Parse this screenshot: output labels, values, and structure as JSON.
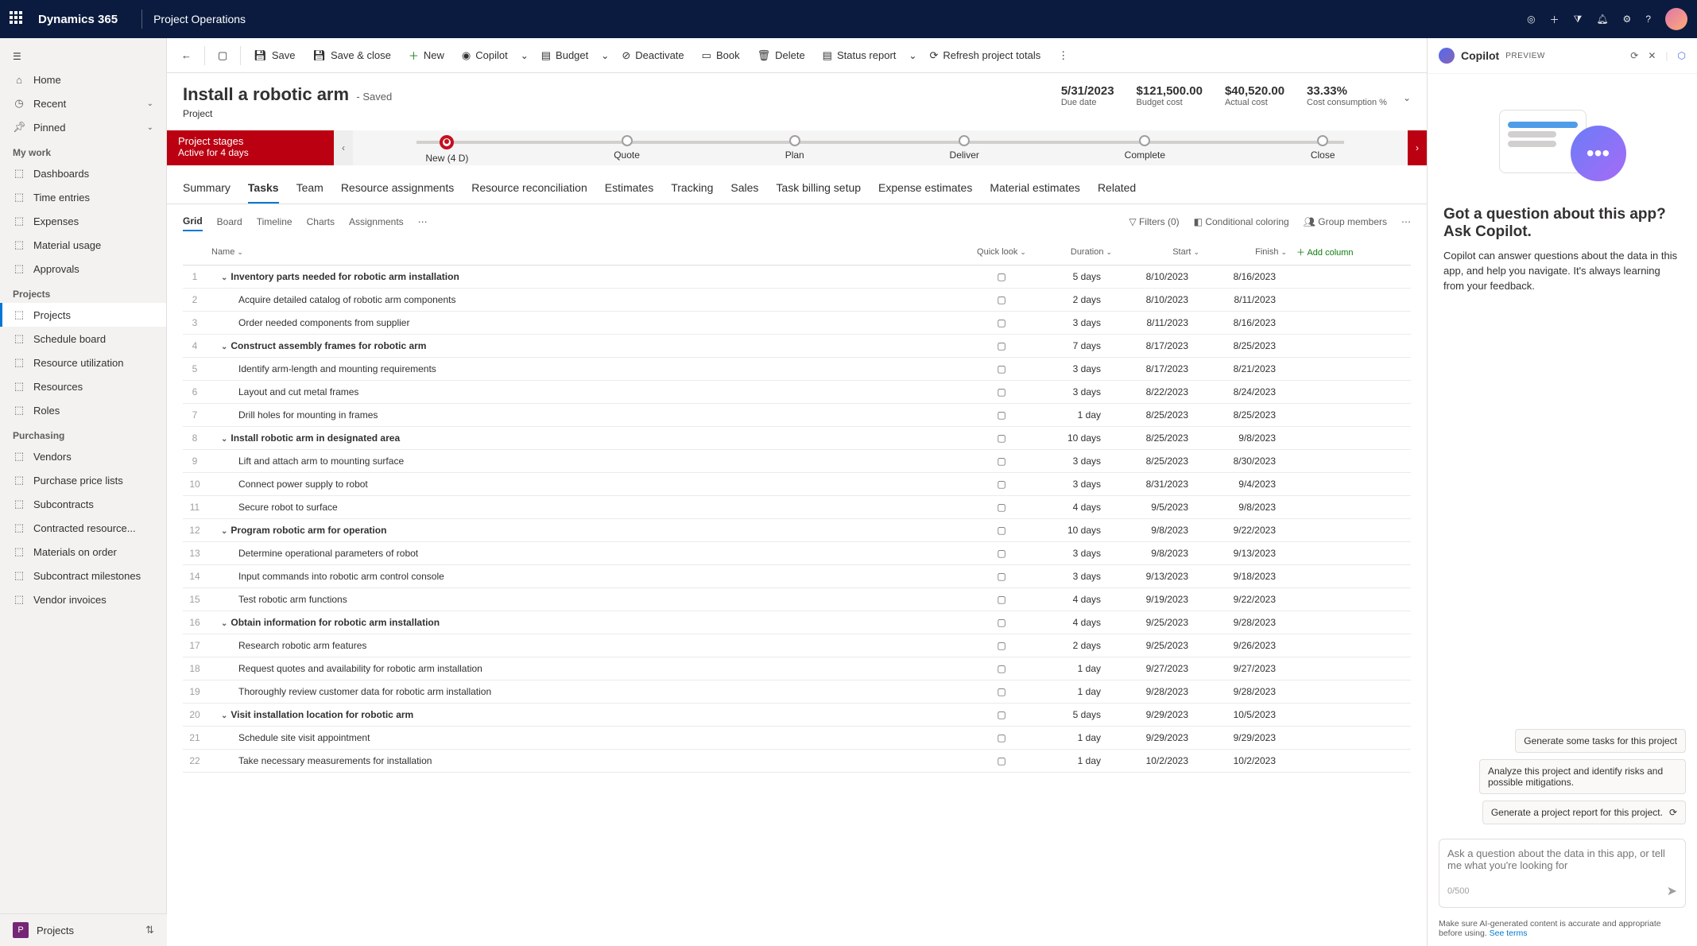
{
  "topbar": {
    "brand": "Dynamics 365",
    "module": "Project Operations"
  },
  "leftnav": {
    "home": "Home",
    "recent": "Recent",
    "pinned": "Pinned",
    "sections": {
      "mywork": {
        "title": "My work",
        "items": [
          "Dashboards",
          "Time entries",
          "Expenses",
          "Material usage",
          "Approvals"
        ]
      },
      "projects": {
        "title": "Projects",
        "items": [
          "Projects",
          "Schedule board",
          "Resource utilization",
          "Resources",
          "Roles"
        ]
      },
      "purchasing": {
        "title": "Purchasing",
        "items": [
          "Vendors",
          "Purchase price lists",
          "Subcontracts",
          "Contracted resource...",
          "Materials on order",
          "Subcontract milestones",
          "Vendor invoices"
        ]
      }
    },
    "bottom": {
      "badge": "P",
      "label": "Projects"
    }
  },
  "cmdbar": {
    "save": "Save",
    "saveclose": "Save & close",
    "new": "New",
    "copilot": "Copilot",
    "budget": "Budget",
    "deactivate": "Deactivate",
    "book": "Book",
    "delete": "Delete",
    "statusreport": "Status report",
    "refresh": "Refresh project totals"
  },
  "record": {
    "title": "Install a robotic arm",
    "saved": "- Saved",
    "subtitle": "Project",
    "metrics": [
      {
        "val": "5/31/2023",
        "lbl": "Due date"
      },
      {
        "val": "$121,500.00",
        "lbl": "Budget cost"
      },
      {
        "val": "$40,520.00",
        "lbl": "Actual cost"
      },
      {
        "val": "33.33%",
        "lbl": "Cost consumption %"
      }
    ]
  },
  "stages": {
    "label_title": "Project stages",
    "label_sub": "Active for 4 days",
    "nodes": [
      "New (4 D)",
      "Quote",
      "Plan",
      "Deliver",
      "Complete",
      "Close"
    ]
  },
  "tabs": [
    "Summary",
    "Tasks",
    "Team",
    "Resource assignments",
    "Resource reconciliation",
    "Estimates",
    "Tracking",
    "Sales",
    "Task billing setup",
    "Expense estimates",
    "Material estimates",
    "Related"
  ],
  "active_tab": "Tasks",
  "subtabs": [
    "Grid",
    "Board",
    "Timeline",
    "Charts",
    "Assignments"
  ],
  "active_subtab": "Grid",
  "gridtools": {
    "filters": "Filters (0)",
    "conditional": "Conditional coloring",
    "group": "Group members"
  },
  "grid": {
    "cols": {
      "name": "Name",
      "quicklook": "Quick look",
      "duration": "Duration",
      "start": "Start",
      "finish": "Finish",
      "addcol": "Add column"
    },
    "rows": [
      {
        "idx": 1,
        "parent": true,
        "name": "Inventory parts needed for robotic arm installation",
        "dur": "5 days",
        "start": "8/10/2023",
        "finish": "8/16/2023"
      },
      {
        "idx": 2,
        "name": "Acquire detailed catalog of robotic arm components",
        "dur": "2 days",
        "start": "8/10/2023",
        "finish": "8/11/2023"
      },
      {
        "idx": 3,
        "name": "Order needed components from supplier",
        "dur": "3 days",
        "start": "8/11/2023",
        "finish": "8/16/2023"
      },
      {
        "idx": 4,
        "parent": true,
        "name": "Construct assembly frames for robotic arm",
        "dur": "7 days",
        "start": "8/17/2023",
        "finish": "8/25/2023"
      },
      {
        "idx": 5,
        "name": "Identify arm-length and mounting requirements",
        "dur": "3 days",
        "start": "8/17/2023",
        "finish": "8/21/2023"
      },
      {
        "idx": 6,
        "name": "Layout and cut metal frames",
        "dur": "3 days",
        "start": "8/22/2023",
        "finish": "8/24/2023"
      },
      {
        "idx": 7,
        "name": "Drill holes for mounting in frames",
        "dur": "1 day",
        "start": "8/25/2023",
        "finish": "8/25/2023"
      },
      {
        "idx": 8,
        "parent": true,
        "name": "Install robotic arm in designated area",
        "dur": "10 days",
        "start": "8/25/2023",
        "finish": "9/8/2023"
      },
      {
        "idx": 9,
        "name": "Lift and attach arm to mounting surface",
        "dur": "3 days",
        "start": "8/25/2023",
        "finish": "8/30/2023"
      },
      {
        "idx": 10,
        "name": "Connect power supply to robot",
        "dur": "3 days",
        "start": "8/31/2023",
        "finish": "9/4/2023"
      },
      {
        "idx": 11,
        "name": "Secure robot to surface",
        "dur": "4 days",
        "start": "9/5/2023",
        "finish": "9/8/2023"
      },
      {
        "idx": 12,
        "parent": true,
        "name": "Program robotic arm for operation",
        "dur": "10 days",
        "start": "9/8/2023",
        "finish": "9/22/2023"
      },
      {
        "idx": 13,
        "name": "Determine operational parameters of robot",
        "dur": "3 days",
        "start": "9/8/2023",
        "finish": "9/13/2023"
      },
      {
        "idx": 14,
        "name": "Input commands into robotic arm control console",
        "dur": "3 days",
        "start": "9/13/2023",
        "finish": "9/18/2023"
      },
      {
        "idx": 15,
        "name": "Test robotic arm functions",
        "dur": "4 days",
        "start": "9/19/2023",
        "finish": "9/22/2023"
      },
      {
        "idx": 16,
        "parent": true,
        "name": "Obtain information for robotic arm installation",
        "dur": "4 days",
        "start": "9/25/2023",
        "finish": "9/28/2023"
      },
      {
        "idx": 17,
        "name": "Research robotic arm features",
        "dur": "2 days",
        "start": "9/25/2023",
        "finish": "9/26/2023"
      },
      {
        "idx": 18,
        "name": "Request quotes and availability for robotic arm installation",
        "dur": "1 day",
        "start": "9/27/2023",
        "finish": "9/27/2023"
      },
      {
        "idx": 19,
        "name": "Thoroughly review customer data for robotic arm installation",
        "dur": "1 day",
        "start": "9/28/2023",
        "finish": "9/28/2023"
      },
      {
        "idx": 20,
        "parent": true,
        "name": "Visit installation location for robotic arm",
        "dur": "5 days",
        "start": "9/29/2023",
        "finish": "10/5/2023"
      },
      {
        "idx": 21,
        "name": "Schedule site visit appointment",
        "dur": "1 day",
        "start": "9/29/2023",
        "finish": "9/29/2023"
      },
      {
        "idx": 22,
        "name": "Take necessary measurements for installation",
        "dur": "1 day",
        "start": "10/2/2023",
        "finish": "10/2/2023"
      }
    ]
  },
  "copilot": {
    "title": "Copilot",
    "preview": "PREVIEW",
    "hero_title": "Got a question about this app? Ask Copilot.",
    "hero_body": "Copilot can answer questions about the data in this app, and help you navigate. It's always learning from your feedback.",
    "suggestions": [
      "Generate some tasks for this project",
      "Analyze this project and identify risks and possible mitigations.",
      "Generate a project report for this project."
    ],
    "placeholder": "Ask a question about the data in this app, or tell me what you're looking for",
    "counter": "0/500",
    "disclaimer": "Make sure AI-generated content is accurate and appropriate before using.",
    "terms": "See terms"
  }
}
